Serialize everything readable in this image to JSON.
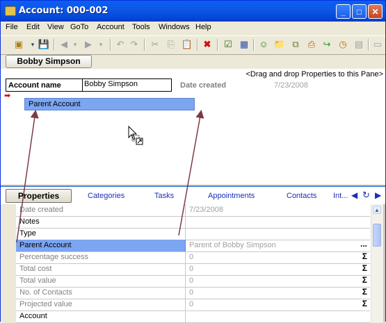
{
  "window": {
    "title": "Account: 000-002"
  },
  "menu": [
    "File",
    "Edit",
    "View",
    "GoTo",
    "Account",
    "Tools",
    "Windows",
    "Help"
  ],
  "record": {
    "name_button": "Bobby Simpson",
    "drop_hint": "<Drag and drop Properties to this Pane>",
    "account_name_label": "Account name",
    "account_name_value": "Bobby Simpson",
    "date_created_label": "Date created",
    "date_created_value": "7/23/2008",
    "parent_account_chip": "Parent Account"
  },
  "tabs": {
    "active": "Properties",
    "items": [
      "Categories",
      "Tasks",
      "Appointments",
      "Contacts",
      "Int..."
    ]
  },
  "properties": [
    {
      "name": "Date created",
      "value": "7/23/2008",
      "summary": ""
    },
    {
      "name": "Notes",
      "value": "",
      "summary": ""
    },
    {
      "name": "Type",
      "value": "",
      "summary": ""
    },
    {
      "name": "Parent Account",
      "value": "Parent of Bobby Simpson",
      "summary": "..."
    },
    {
      "name": "Percentage success",
      "value": "0",
      "summary": "Σ"
    },
    {
      "name": "Total cost",
      "value": "0",
      "summary": "Σ"
    },
    {
      "name": "Total value",
      "value": "0",
      "summary": "Σ"
    },
    {
      "name": "No. of Contacts",
      "value": "0",
      "summary": "Σ"
    },
    {
      "name": "Projected value",
      "value": "0",
      "summary": "Σ"
    },
    {
      "name": "Account",
      "value": "",
      "summary": ""
    }
  ],
  "icons": {
    "titlebar_buttons": [
      "minimize-icon",
      "maximize-icon",
      "close-icon"
    ]
  },
  "colors": {
    "title_blue": "#0a5ef6",
    "selection_blue": "#7ca5f2",
    "tab_link": "#1a2fb8",
    "arrow_maroon": "#7a3b45"
  }
}
